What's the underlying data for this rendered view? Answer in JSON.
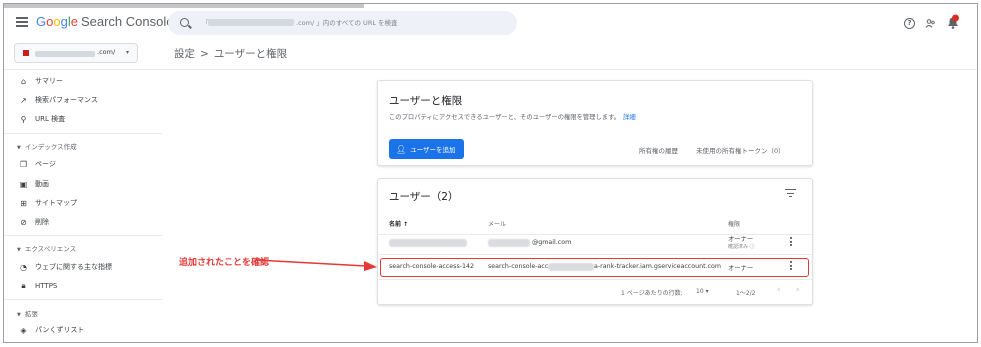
{
  "header": {
    "brand": {
      "g": "G",
      "o1": "o",
      "o2": "o",
      "g2": "g",
      "l": "l",
      "e": "e",
      "rest": "Search Console"
    },
    "search_prefix": "「",
    "search_text": ".com/ 」内のすべての URL を検査",
    "icons": [
      "menu-icon",
      "search-icon",
      "help-icon",
      "people-icon",
      "notifications-icon"
    ]
  },
  "property": {
    "domain_suffix": ".com/",
    "caret": "▾"
  },
  "breadcrumb": {
    "parent": "設定",
    "separator": ">",
    "current": "ユーザーと権限"
  },
  "sidebar": {
    "items_top": [
      {
        "icon": "home-icon",
        "label": "サマリー"
      },
      {
        "icon": "trending-icon",
        "label": "検索パフォーマンス"
      },
      {
        "icon": "search-icon",
        "label": "URL 検査"
      }
    ],
    "index_section": "インデックス作成",
    "index_items": [
      {
        "icon": "pages-icon",
        "label": "ページ"
      },
      {
        "icon": "video-icon",
        "label": "動画"
      },
      {
        "icon": "sitemap-icon",
        "label": "サイトマップ"
      },
      {
        "icon": "removals-icon",
        "label": "削除"
      }
    ],
    "experience_section": "エクスペリエンス",
    "experience_items": [
      {
        "icon": "web-vitals-icon",
        "label": "ウェブに関する主な指標"
      },
      {
        "icon": "lock-icon",
        "label": "HTTPS"
      }
    ],
    "enhancements_section": "拡張",
    "enhancements_items": [
      {
        "icon": "breadcrumb-icon",
        "label": "パンくずリスト"
      }
    ]
  },
  "permissions_card": {
    "title": "ユーザーと権限",
    "description": "このプロパティにアクセスできるユーザーと、そのユーザーの権限を管理します。",
    "details_link": "詳細",
    "add_user_label": "ユーザーを追加",
    "ownership_history": "所有権の履歴",
    "unused_tokens": "未使用の所有権トークン（0）"
  },
  "users_card": {
    "title": "ユーザー（2）",
    "columns": {
      "name": "名前",
      "sort": "↑",
      "email": "メール",
      "permission": "権限"
    },
    "rows": [
      {
        "name": "",
        "email": "@gmail.com",
        "permission": "オーナー",
        "sub": "確認済み ⓘ"
      },
      {
        "name": "search-console-access-142",
        "email_prefix": "search-console-acc",
        "email_suffix": "a-rank-tracker.iam.gserviceaccount.com",
        "permission": "オーナー"
      }
    ],
    "pager": {
      "rows_per_page_label": "1 ページあたりの行数:",
      "rows_per_page": "10",
      "dropdown": "▾",
      "range": "1〜2/2",
      "prev": "‹",
      "next": "›"
    }
  },
  "annotation": {
    "text": "追加されたことを確認",
    "color": "#e53935"
  },
  "colors": {
    "accent": "#1a73e8",
    "annotation": "#e53935",
    "text": "#202124"
  }
}
